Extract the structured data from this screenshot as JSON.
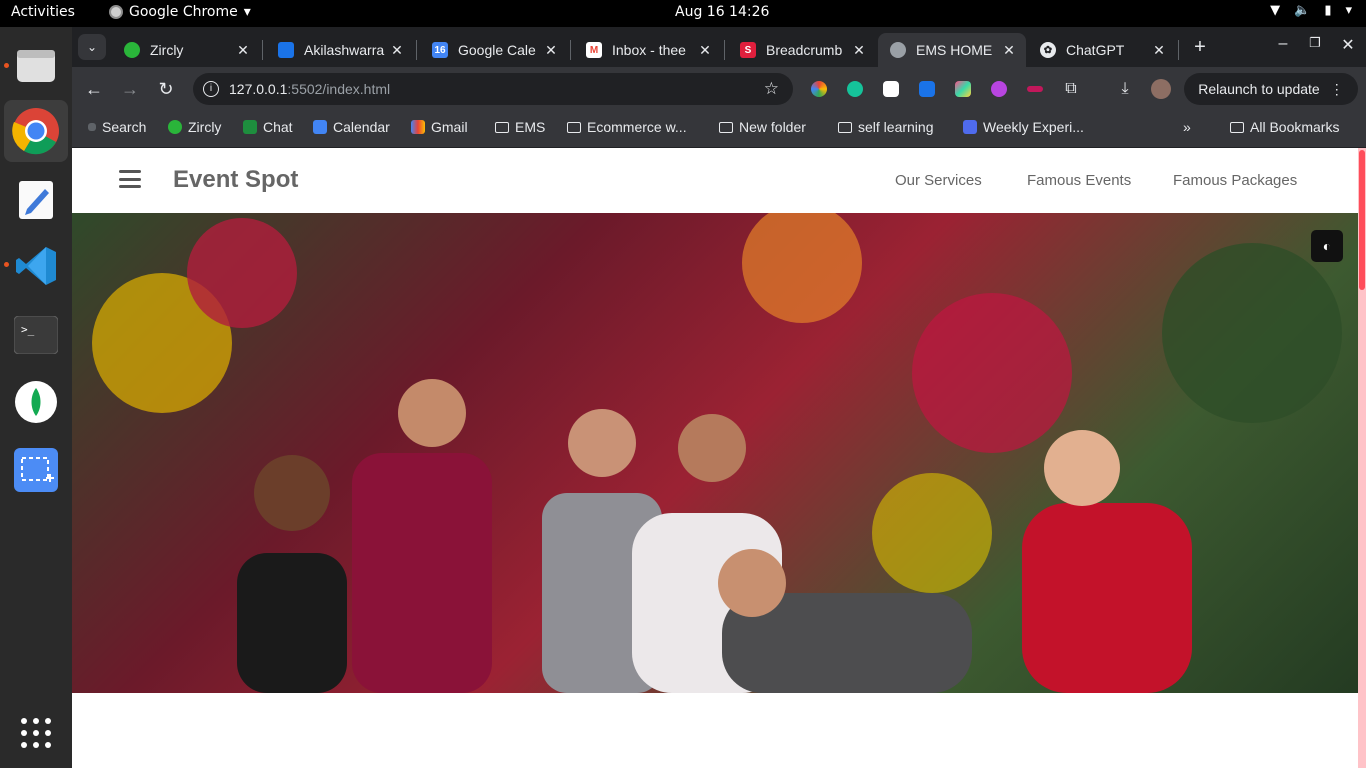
{
  "system": {
    "activities": "Activities",
    "app_name": "Google Chrome",
    "clock": "Aug 16  14:26"
  },
  "tabs": [
    {
      "title": "Zircly",
      "favicon_color": "#2ab53a"
    },
    {
      "title": "Akilashwarra",
      "favicon_color": "#1a73e8"
    },
    {
      "title": "Google Cale",
      "favicon_color": "#4285f4"
    },
    {
      "title": "Inbox - thee",
      "favicon_color": "#ea4335"
    },
    {
      "title": "Breadcrumb",
      "favicon_color": "#e01f3d"
    },
    {
      "title": "EMS HOME",
      "favicon_color": "#9aa0a6",
      "active": true
    },
    {
      "title": "ChatGPT",
      "favicon_color": "#e8eaed"
    }
  ],
  "toolbar": {
    "url_host": "127.0.0.1",
    "url_path": ":5502/index.html",
    "relaunch_label": "Relaunch to update"
  },
  "bookmarks": [
    {
      "label": "Search"
    },
    {
      "label": "Zircly"
    },
    {
      "label": "Chat"
    },
    {
      "label": "Calendar"
    },
    {
      "label": "Gmail"
    },
    {
      "label": "EMS"
    },
    {
      "label": "Ecommerce w..."
    },
    {
      "label": "New folder"
    },
    {
      "label": "self learning"
    },
    {
      "label": "Weekly Experi..."
    },
    {
      "label": "All Bookmarks"
    }
  ],
  "site": {
    "brand": "Event Spot",
    "nav": [
      "Our Services",
      "Famous Events",
      "Famous Packages"
    ]
  }
}
